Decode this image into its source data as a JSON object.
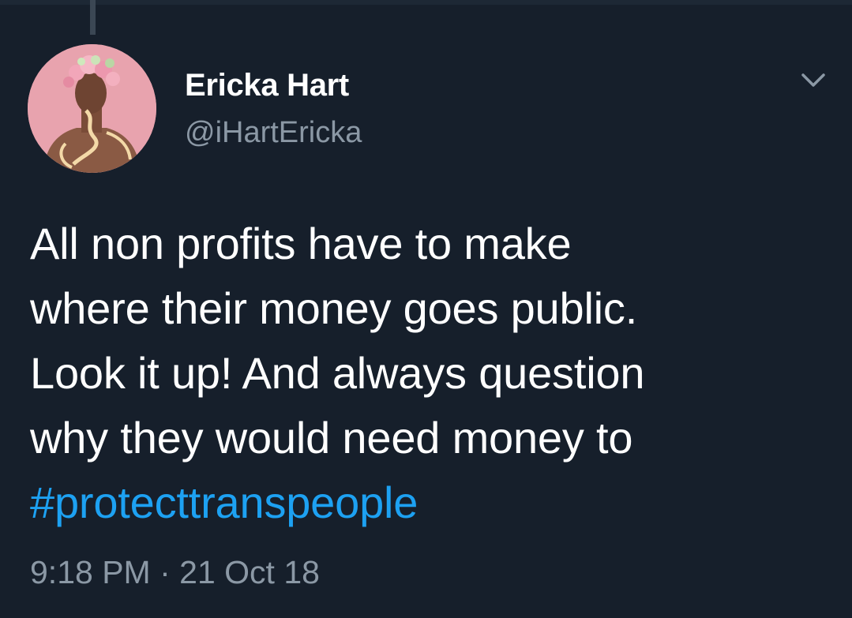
{
  "tweet": {
    "author": {
      "display_name": "Ericka Hart",
      "handle": "@iHartEricka",
      "avatar_icon": "profile-photo-avatar"
    },
    "menu_icon": "chevron-down-icon",
    "body_lines": [
      "All non profits have to make",
      "where their money goes public.",
      "Look it up! And always question",
      "why they would need money to"
    ],
    "hashtag": "#protecttranspeople",
    "time": "9:18 PM",
    "separator": "·",
    "date": "21 Oct 18"
  },
  "colors": {
    "background": "#161f2b",
    "text": "#ffffff",
    "secondary_text": "#8b98a5",
    "link": "#1da1f2",
    "thread_line": "#3b4754"
  }
}
